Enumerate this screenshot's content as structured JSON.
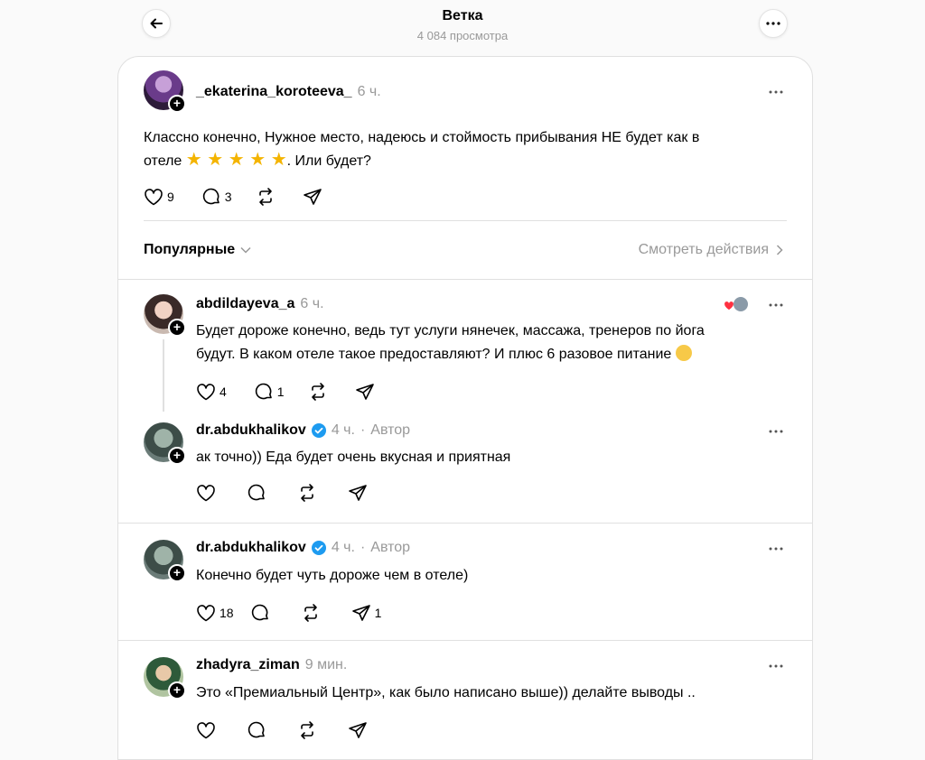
{
  "header": {
    "title": "Ветка",
    "views": "4 084 просмотра"
  },
  "main_post": {
    "username": "_ekaterina_koroteeva_",
    "time": "6 ч.",
    "text_line1": "Классно конечно, Нужное место, надеюсь и стоймость прибывания НЕ будет как в",
    "text_line2_prefix": "отеле",
    "text_line2_suffix": ". Или будет?",
    "stars": "★ ★ ★ ★ ★",
    "likes": "9",
    "comments": "3"
  },
  "sort": {
    "label": "Популярные",
    "activity_link": "Смотреть действия"
  },
  "replies": [
    {
      "username": "abdildayeva_a",
      "time": "6 ч.",
      "text_line1": "Будет дороже конечно, ведь тут услуги нянечек, массажа, тренеров по йога",
      "text_line2": "будут. В каком отеле такое предоставляют? И плюс 6 разовое питание",
      "likes": "4",
      "comments": "1"
    },
    {
      "username": "dr.abdukhalikov",
      "time": "4 ч.",
      "author_label": "Автор",
      "text_line1": "ак точно)) Еда будет очень вкусная и приятная"
    },
    {
      "username": "dr.abdukhalikov",
      "time": "4 ч.",
      "author_label": "Автор",
      "text_line1": "Конечно будет чуть дороже чем в отеле)",
      "likes": "18",
      "shares": "1"
    },
    {
      "username": "zhadyra_ziman",
      "time": "9 мин.",
      "text_line1": "Это «Премиальный Центр», как было написано выше)) делайте выводы .."
    }
  ],
  "colors": {
    "verified": "#1d9bf0",
    "muted": "#999999",
    "star": "#f4b400"
  },
  "icons": [
    "back-arrow-icon",
    "more-icon",
    "heart-icon",
    "comment-icon",
    "repost-icon",
    "share-icon",
    "verified-icon",
    "chevron-down-icon",
    "chevron-right-icon",
    "follow-plus-icon"
  ]
}
